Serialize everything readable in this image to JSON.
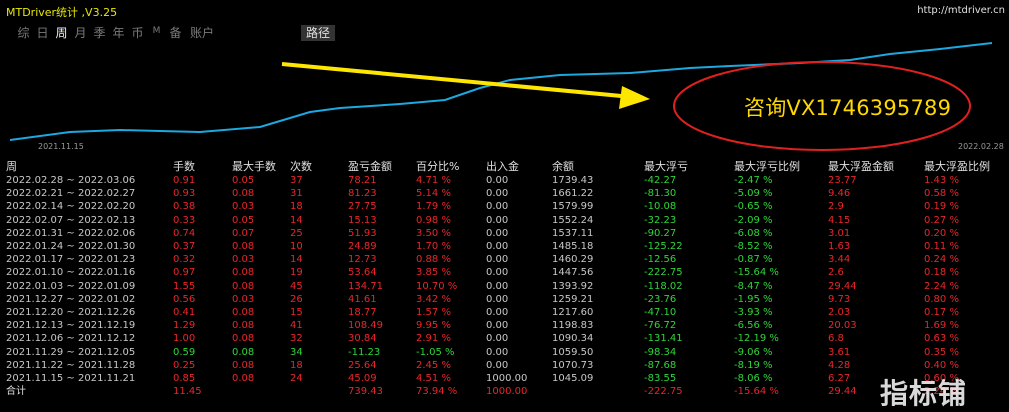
{
  "app": {
    "title": "MTDriver统计 ,V3.25",
    "url": "http://mtdriver.cn"
  },
  "tabs": [
    "综",
    "日",
    "周",
    "月",
    "季",
    "年",
    "币",
    "M",
    "备",
    "账户"
  ],
  "active_tab": "周",
  "path_button": "路径",
  "chart": {
    "x_start": "2021.11.15",
    "x_end": "2022.02.28",
    "line_color": "#1da8e0",
    "arrow_color": "#ffe600",
    "circle_color": "#e02020",
    "contact_text": "咨询VX1746395789"
  },
  "table": {
    "headers": [
      "周",
      "手数",
      "最大手数",
      "次数",
      "盈亏金额",
      "百分比%",
      "出入金",
      "余额",
      "最大浮亏",
      "最大浮亏比例",
      "最大浮盈金额",
      "最大浮盈比例"
    ],
    "rows": [
      [
        "2022.02.28 ~ 2022.03.06",
        "0.91",
        "0.05",
        "37",
        "78.21",
        "4.71 %",
        "0.00",
        "1739.43",
        "-42.27",
        "-2.47 %",
        "23.77",
        "1.43 %"
      ],
      [
        "2022.02.21 ~ 2022.02.27",
        "0.93",
        "0.08",
        "31",
        "81.23",
        "5.14 %",
        "0.00",
        "1661.22",
        "-81.30",
        "-5.09 %",
        "9.46",
        "0.58 %"
      ],
      [
        "2022.02.14 ~ 2022.02.20",
        "0.38",
        "0.03",
        "18",
        "27.75",
        "1.79 %",
        "0.00",
        "1579.99",
        "-10.08",
        "-0.65 %",
        "2.9",
        "0.19 %"
      ],
      [
        "2022.02.07 ~ 2022.02.13",
        "0.33",
        "0.05",
        "14",
        "15.13",
        "0.98 %",
        "0.00",
        "1552.24",
        "-32.23",
        "-2.09 %",
        "4.15",
        "0.27 %"
      ],
      [
        "2022.01.31 ~ 2022.02.06",
        "0.74",
        "0.07",
        "25",
        "51.93",
        "3.50 %",
        "0.00",
        "1537.11",
        "-90.27",
        "-6.08 %",
        "3.01",
        "0.20 %"
      ],
      [
        "2022.01.24 ~ 2022.01.30",
        "0.37",
        "0.08",
        "10",
        "24.89",
        "1.70 %",
        "0.00",
        "1485.18",
        "-125.22",
        "-8.52 %",
        "1.63",
        "0.11 %"
      ],
      [
        "2022.01.17 ~ 2022.01.23",
        "0.32",
        "0.03",
        "14",
        "12.73",
        "0.88 %",
        "0.00",
        "1460.29",
        "-12.56",
        "-0.87 %",
        "3.44",
        "0.24 %"
      ],
      [
        "2022.01.10 ~ 2022.01.16",
        "0.97",
        "0.08",
        "19",
        "53.64",
        "3.85 %",
        "0.00",
        "1447.56",
        "-222.75",
        "-15.64 %",
        "2.6",
        "0.18 %"
      ],
      [
        "2022.01.03 ~ 2022.01.09",
        "1.55",
        "0.08",
        "45",
        "134.71",
        "10.70 %",
        "0.00",
        "1393.92",
        "-118.02",
        "-8.47 %",
        "29.44",
        "2.24 %"
      ],
      [
        "2021.12.27 ~ 2022.01.02",
        "0.56",
        "0.03",
        "26",
        "41.61",
        "3.42 %",
        "0.00",
        "1259.21",
        "-23.76",
        "-1.95 %",
        "9.73",
        "0.80 %"
      ],
      [
        "2021.12.20 ~ 2021.12.26",
        "0.41",
        "0.08",
        "15",
        "18.77",
        "1.57 %",
        "0.00",
        "1217.60",
        "-47.10",
        "-3.93 %",
        "2.03",
        "0.17 %"
      ],
      [
        "2021.12.13 ~ 2021.12.19",
        "1.29",
        "0.08",
        "41",
        "108.49",
        "9.95 %",
        "0.00",
        "1198.83",
        "-76.72",
        "-6.56 %",
        "20.03",
        "1.69 %"
      ],
      [
        "2021.12.06 ~ 2021.12.12",
        "1.00",
        "0.08",
        "32",
        "30.84",
        "2.91 %",
        "0.00",
        "1090.34",
        "-131.41",
        "-12.19 %",
        "6.8",
        "0.63 %"
      ],
      [
        "2021.11.29 ~ 2021.12.05",
        "0.59",
        "0.08",
        "34",
        "-11.23",
        "-1.05 %",
        "0.00",
        "1059.50",
        "-98.34",
        "-9.06 %",
        "3.61",
        "0.35 %"
      ],
      [
        "2021.11.22 ~ 2021.11.28",
        "0.25",
        "0.08",
        "18",
        "25.64",
        "2.45 %",
        "0.00",
        "1070.73",
        "-87.68",
        "-8.19 %",
        "4.28",
        "0.40 %"
      ],
      [
        "2021.11.15 ~ 2021.11.21",
        "0.85",
        "0.08",
        "24",
        "45.09",
        "4.51 %",
        "1000.00",
        "1045.09",
        "-83.55",
        "-8.06 %",
        "6.27",
        "0.60 %"
      ]
    ],
    "summary": [
      "合计",
      "11.45",
      "",
      "",
      "739.43",
      "73.94 %",
      "1000.00",
      "",
      "-222.75",
      "-15.64 %",
      "29.44",
      "2.24 %"
    ]
  },
  "watermark": "指标铺"
}
